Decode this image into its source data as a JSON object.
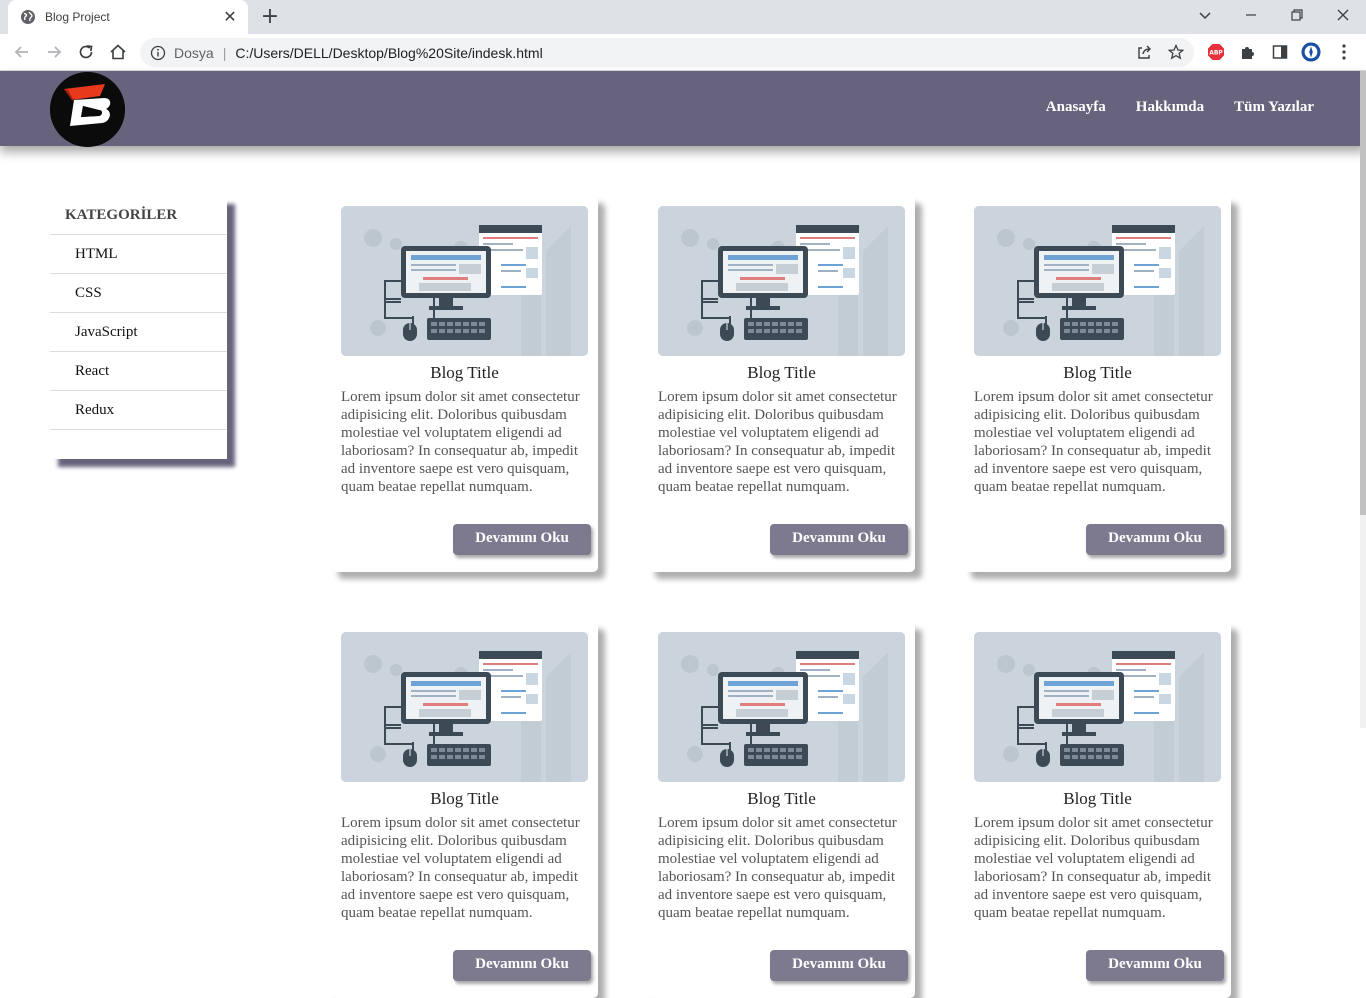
{
  "browser": {
    "tab_title": "Blog Project",
    "tab_close": "✕",
    "new_tab": "+",
    "omnibox_scheme": "Dosya",
    "omnibox_sep": "|",
    "omnibox_url": "C:/Users/DELL/Desktop/Blog%20Site/indesk.html"
  },
  "site": {
    "nav": [
      "Anasayfa",
      "Hakkımda",
      "Tüm Yazılar"
    ],
    "categories": {
      "title": "KATEGORİLER",
      "items": [
        "HTML",
        "CSS",
        "JavaScript",
        "React",
        "Redux"
      ]
    },
    "cards": [
      {
        "title": "Blog Title",
        "text": "Lorem ipsum dolor sit amet consectetur adipisicing elit. Doloribus quibusdam molestiae vel voluptatem eligendi ad laboriosam? In consequatur ab, impedit ad inventore saepe est vero quisquam, quam beatae repellat numquam.",
        "button": "Devamını Oku"
      },
      {
        "title": "Blog Title",
        "text": "Lorem ipsum dolor sit amet consectetur adipisicing elit. Doloribus quibusdam molestiae vel voluptatem eligendi ad laboriosam? In consequatur ab, impedit ad inventore saepe est vero quisquam, quam beatae repellat numquam.",
        "button": "Devamını Oku"
      },
      {
        "title": "Blog Title",
        "text": "Lorem ipsum dolor sit amet consectetur adipisicing elit. Doloribus quibusdam molestiae vel voluptatem eligendi ad laboriosam? In consequatur ab, impedit ad inventore saepe est vero quisquam, quam beatae repellat numquam.",
        "button": "Devamını Oku"
      },
      {
        "title": "Blog Title",
        "text": "Lorem ipsum dolor sit amet consectetur adipisicing elit. Doloribus quibusdam molestiae vel voluptatem eligendi ad laboriosam? In consequatur ab, impedit ad inventore saepe est vero quisquam, quam beatae repellat numquam.",
        "button": "Devamını Oku"
      },
      {
        "title": "Blog Title",
        "text": "Lorem ipsum dolor sit amet consectetur adipisicing elit. Doloribus quibusdam molestiae vel voluptatem eligendi ad laboriosam? In consequatur ab, impedit ad inventore saepe est vero quisquam, quam beatae repellat numquam.",
        "button": "Devamını Oku"
      },
      {
        "title": "Blog Title",
        "text": "Lorem ipsum dolor sit amet consectetur adipisicing elit. Doloribus quibusdam molestiae vel voluptatem eligendi ad laboriosam? In consequatur ab, impedit ad inventore saepe est vero quisquam, quam beatae repellat numquam.",
        "button": "Devamını Oku"
      }
    ]
  },
  "colors": {
    "header_bg": "#67637c",
    "button_bg": "#7d7a8f",
    "logo_accent": "#e8391c"
  },
  "icons": {
    "tab": "globe-icon",
    "back": "arrow-left-icon",
    "forward": "arrow-right-icon",
    "reload": "reload-icon",
    "home": "home-icon",
    "info": "info-icon",
    "share": "share-icon",
    "bookmark": "star-icon",
    "adblock": "abp-icon",
    "extensions": "puzzle-icon",
    "sidepanel": "side-panel-icon",
    "profile": "avatar-icon",
    "menu": "kebab-menu-icon"
  }
}
